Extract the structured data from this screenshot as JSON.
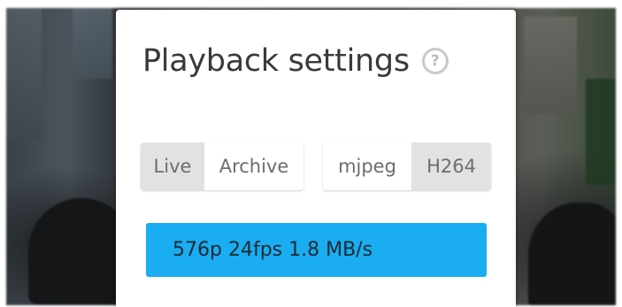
{
  "dialog": {
    "title": "Playback settings",
    "help_icon": "question-circle-icon"
  },
  "mode_toggle": {
    "options": [
      "Live",
      "Archive"
    ],
    "selected": "Live"
  },
  "codec_toggle": {
    "options": [
      "mjpeg",
      "H264"
    ],
    "selected": "H264"
  },
  "quality": {
    "label": "576p 24fps 1.8 MB/s"
  },
  "colors": {
    "accent": "#1aadf1",
    "segment_active": "#e2e2e2",
    "title_text": "#3a3a3a",
    "segment_text": "#6d6d6d"
  }
}
